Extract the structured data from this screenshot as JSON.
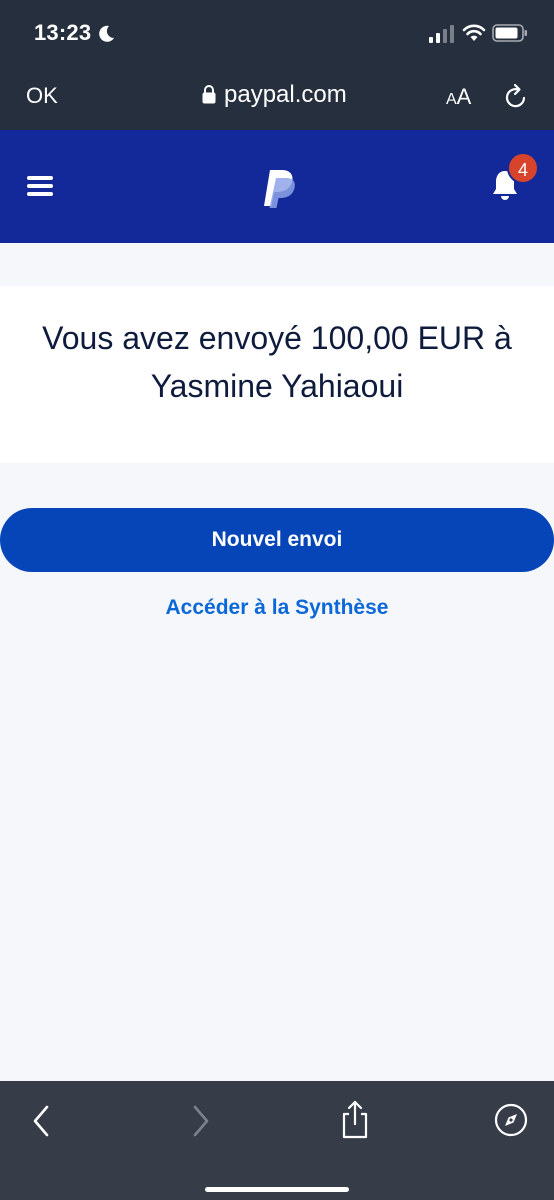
{
  "status_bar": {
    "time": "13:23"
  },
  "browser": {
    "done_label": "OK",
    "url": "paypal.com",
    "text_size_small": "A",
    "text_size_large": "A"
  },
  "header": {
    "notification_count": "4"
  },
  "confirmation": {
    "message": "Vous avez envoyé 100,00 EUR à Yasmine Yahiaoui"
  },
  "actions": {
    "new_send_label": "Nouvel envoi",
    "summary_link_label": "Accéder à la Synthèse"
  },
  "colors": {
    "header_bg": "#13299a",
    "primary_button": "#0645b8",
    "link": "#0c68d8",
    "badge": "#d8442b",
    "browser_chrome": "#262f3d"
  },
  "icons": [
    "moon-icon",
    "signal-icon",
    "wifi-icon",
    "battery-icon",
    "lock-icon",
    "reload-icon",
    "menu-icon",
    "paypal-logo",
    "bell-icon",
    "back-icon",
    "forward-icon",
    "share-icon",
    "compass-icon"
  ]
}
